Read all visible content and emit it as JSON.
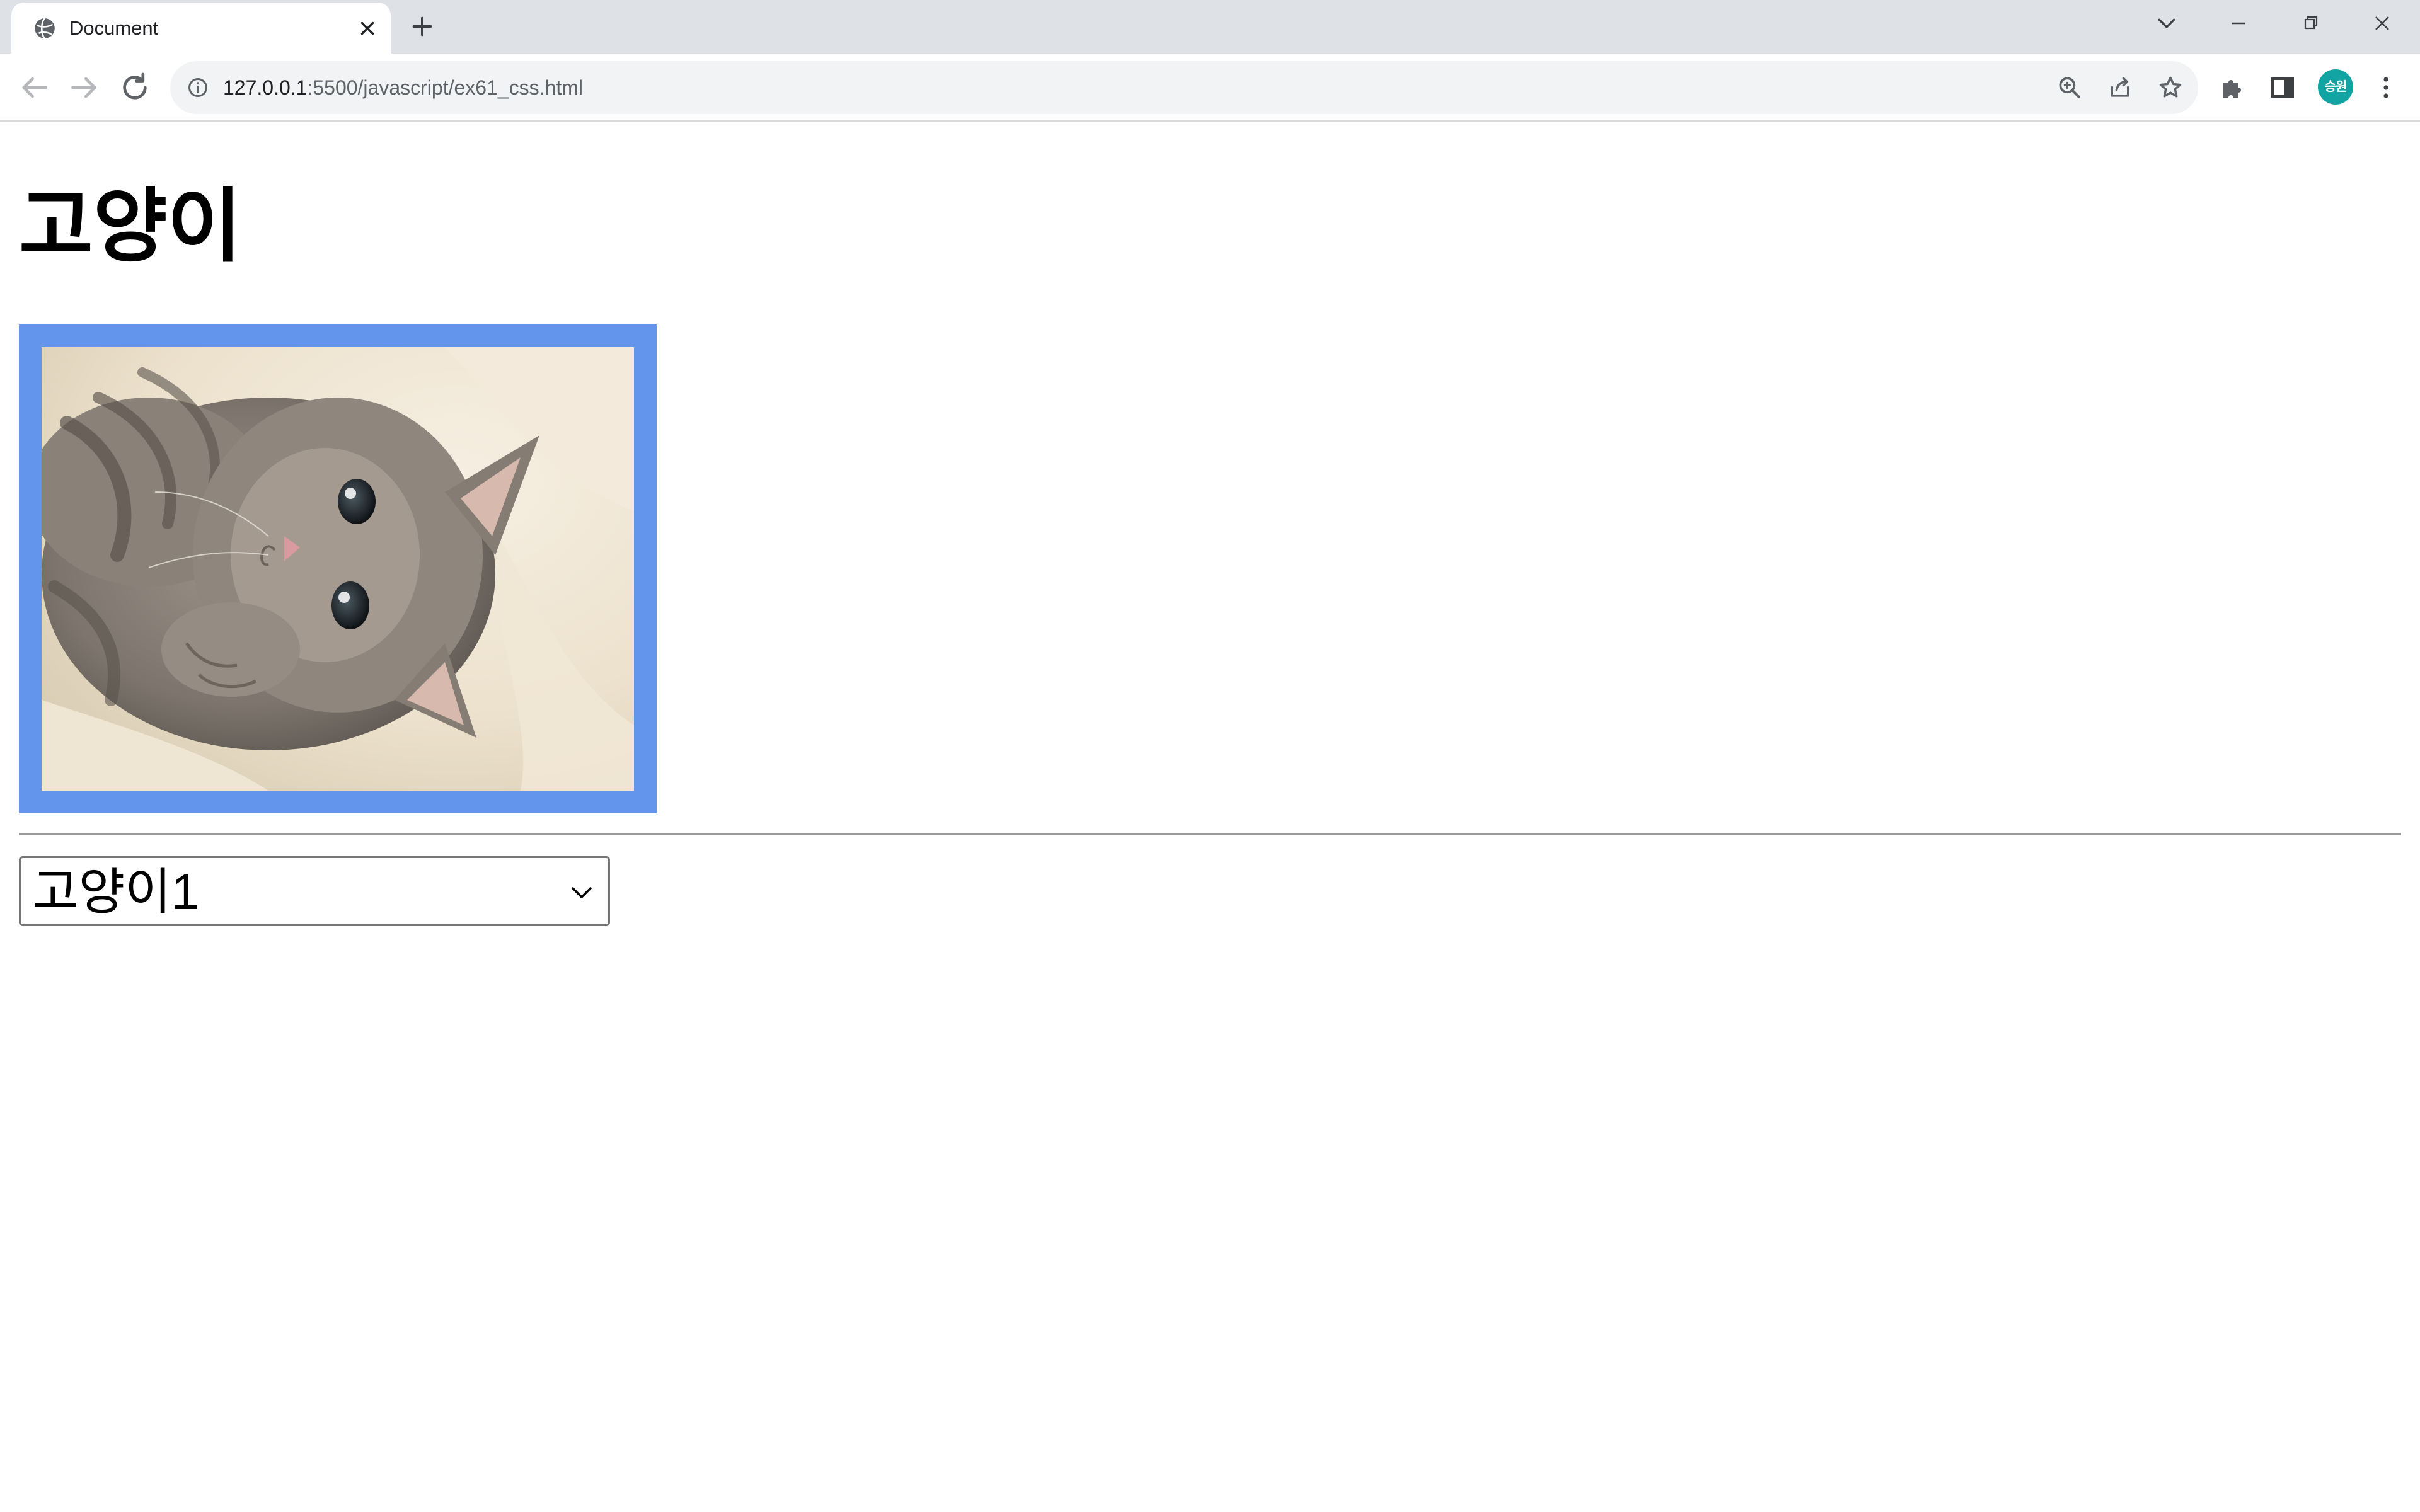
{
  "browser": {
    "tab": {
      "title": "Document",
      "favicon": "globe-icon",
      "close_icon": "close-icon"
    },
    "new_tab_icon": "plus-icon",
    "tab_search_icon": "chevron-down-icon",
    "window_controls": [
      "minimize-icon",
      "restore-icon",
      "close-icon"
    ],
    "address_bar": {
      "url_host": "127.0.0.1",
      "url_path": ":5500/javascript/ex61_css.html",
      "site_info_icon": "info-icon",
      "actions": [
        "zoom-icon",
        "share-icon",
        "star-icon"
      ]
    },
    "toolbar": {
      "back_icon": "back-arrow-icon",
      "forward_icon": "forward-arrow-icon",
      "reload_icon": "reload-icon",
      "extensions_icon": "puzzle-icon",
      "side_panel_icon": "side-panel-icon",
      "profile_initials": "승원",
      "menu_icon": "kebab-menu-icon"
    }
  },
  "page": {
    "heading": "고양이",
    "image": {
      "subject": "grey tabby kitten lying on a cream blanket",
      "border_color": "#6495ed"
    },
    "select": {
      "selected": "고양이1"
    }
  },
  "colors": {
    "tabstrip_bg": "#dee1e6",
    "omnibox_bg": "#f1f3f4",
    "avatar_bg": "#12a4a2",
    "frame_border": "#6495ed"
  }
}
